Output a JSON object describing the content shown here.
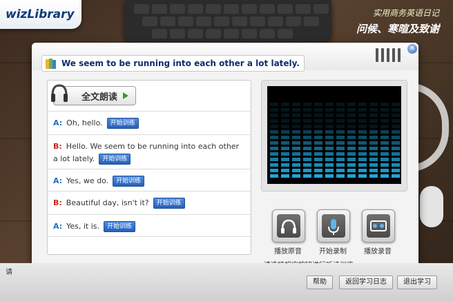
{
  "app": {
    "logo_text": "wizLibrary",
    "course_name": "实用商务英语日记",
    "lesson_title": "问候、寒暄及致谢"
  },
  "sentence_title": "We seem to be running into each other a lot lately.",
  "read_all": {
    "label": "全文朗读"
  },
  "dialogue": [
    {
      "speaker": "A:",
      "text": "Oh, hello.",
      "button": "开始训练"
    },
    {
      "speaker": "B:",
      "text": "Hello. We seem to be running into each other a lot lately.",
      "button": "开始训练"
    },
    {
      "speaker": "A:",
      "text": "Yes, we do.",
      "button": "开始训练"
    },
    {
      "speaker": "B:",
      "text": "Beautiful day, isn't it?",
      "button": "开始训练"
    },
    {
      "speaker": "A:",
      "text": "Yes, it is.",
      "button": "开始训练"
    }
  ],
  "controls": {
    "play_original": "播放原音",
    "start_record": "开始录制",
    "play_record": "播放录音",
    "hint": "请选择相应按钮进行听读训练。"
  },
  "status_text": "请",
  "bottom_buttons": {
    "help": "帮助",
    "back": "返回学习日志",
    "exit": "退出学习"
  },
  "colors": {
    "accent_blue": "#1d6fc4",
    "speaker_b_red": "#c7281f",
    "eq_cyan": "#1fb3e8"
  }
}
